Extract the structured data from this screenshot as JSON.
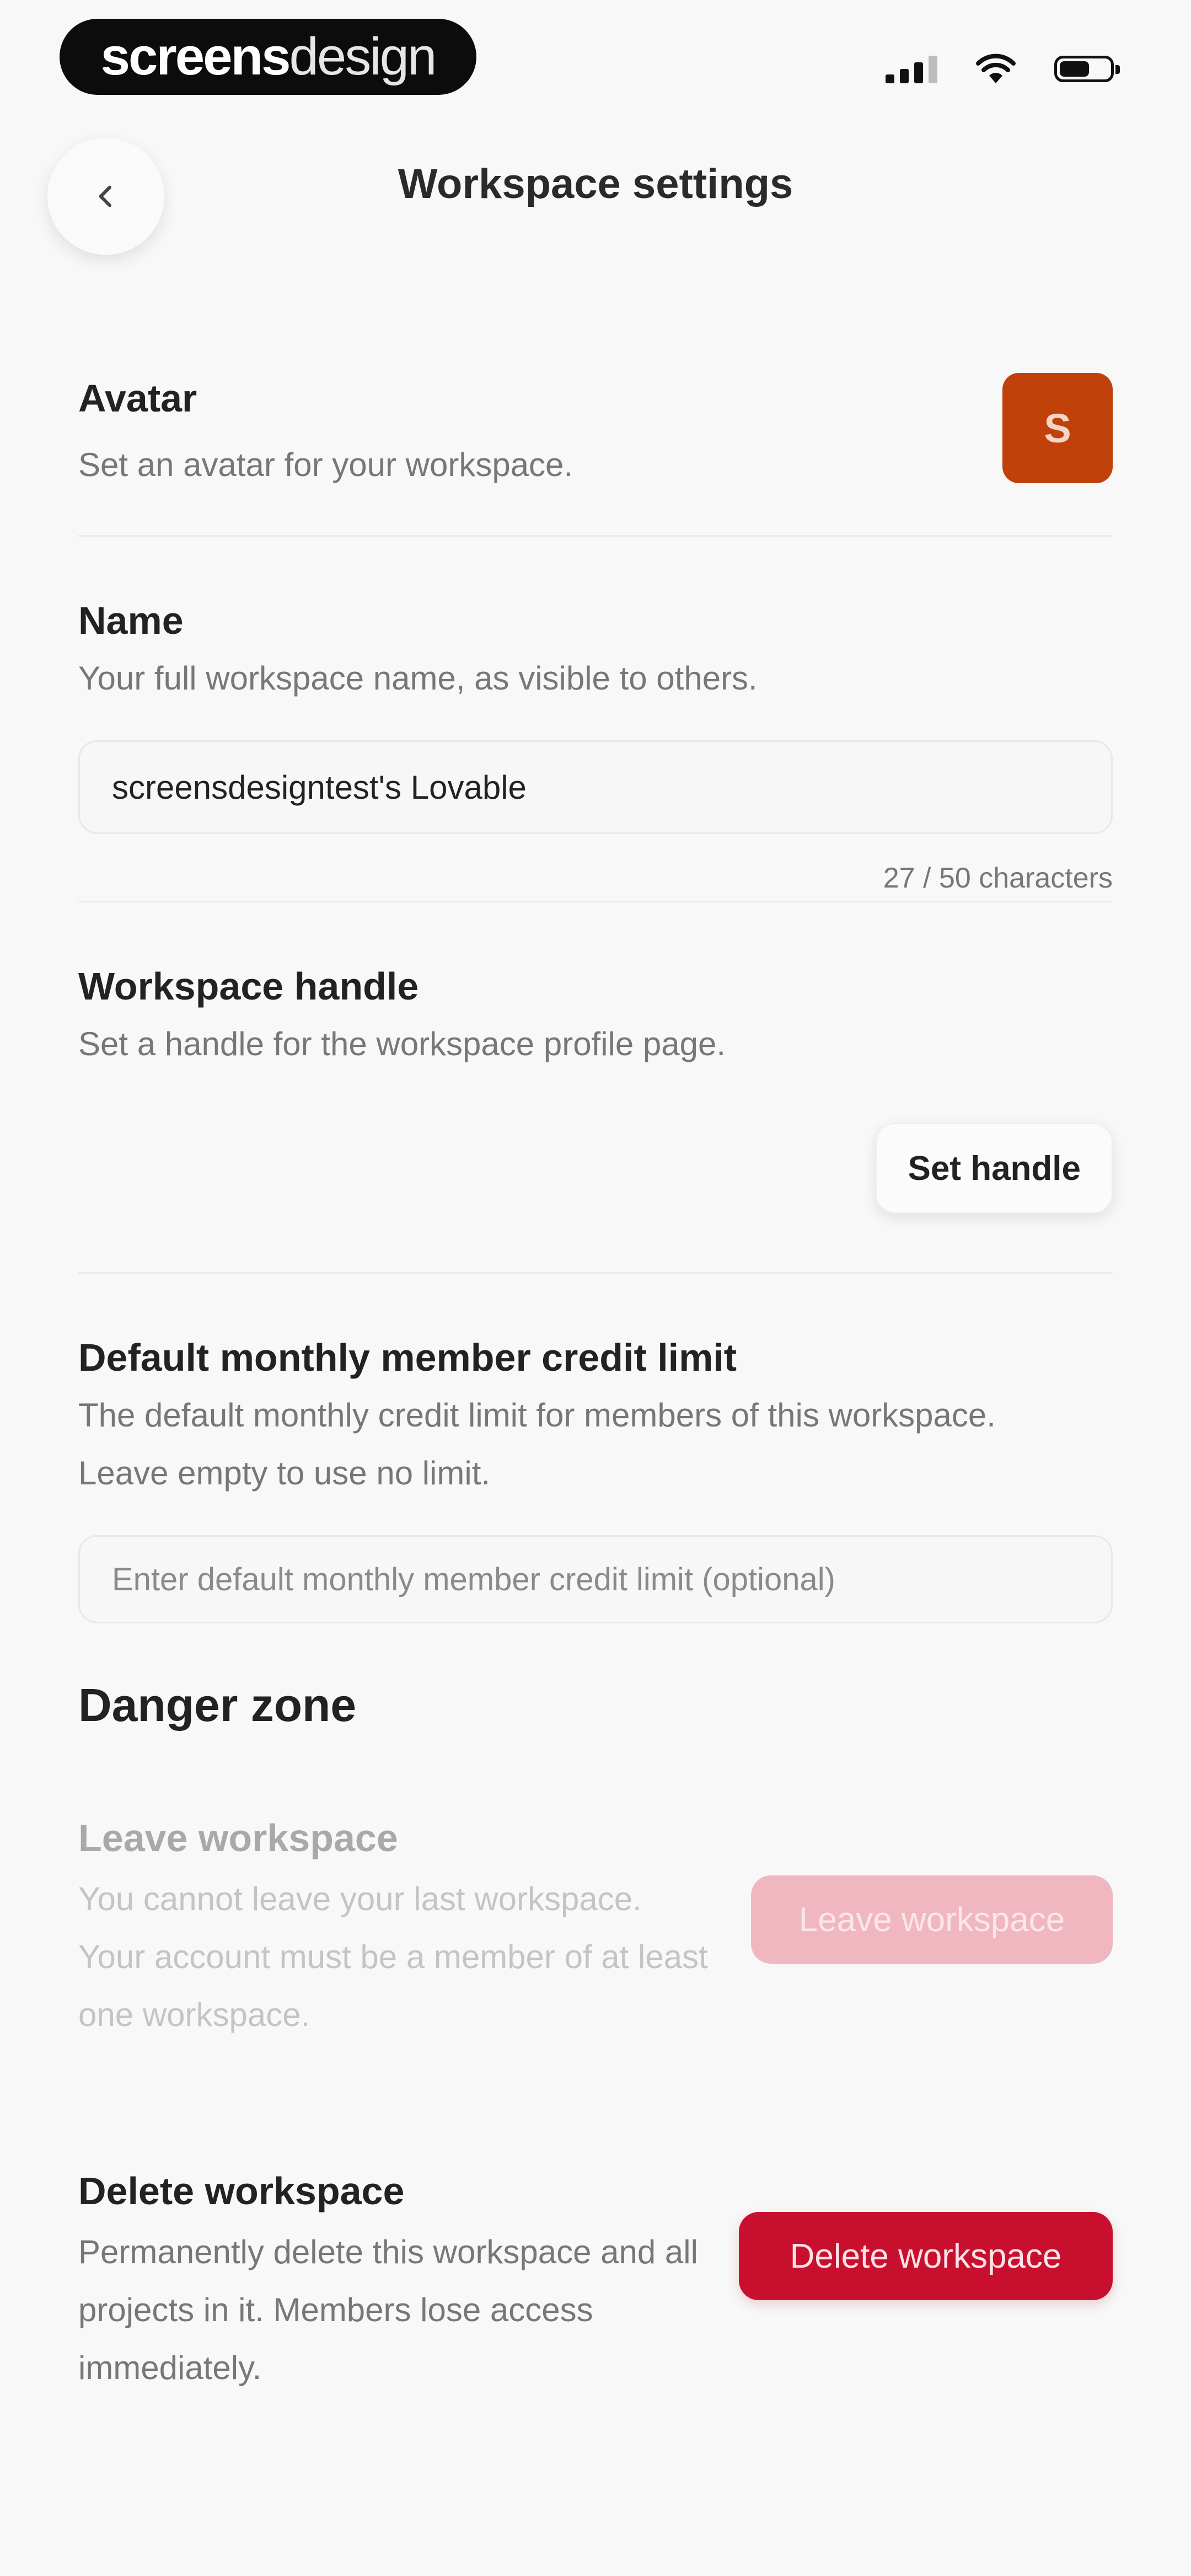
{
  "status_bar": {
    "brand_bold": "screens",
    "brand_light": "design",
    "battery_level": 0.6,
    "icons": [
      "signal-icon",
      "wifi-icon",
      "battery-icon"
    ]
  },
  "header": {
    "title": "Workspace settings",
    "back_icon": "chevron-left-icon"
  },
  "avatar": {
    "label": "Avatar",
    "description": "Set an avatar for your workspace.",
    "initial": "S",
    "color": "#c1410b"
  },
  "name": {
    "label": "Name",
    "description": "Your full workspace name, as visible to others.",
    "value": "screensdesigntest's Lovable",
    "counter": "27 / 50 characters"
  },
  "handle": {
    "label": "Workspace handle",
    "description": "Set a handle for the workspace profile page.",
    "button": "Set handle"
  },
  "credit_limit": {
    "label": "Default monthly member credit limit",
    "description": "The default monthly credit limit for members of this workspace. Leave empty to use no limit.",
    "placeholder": "Enter default monthly member credit limit (optional)"
  },
  "danger_zone": {
    "title": "Danger zone",
    "leave": {
      "label": "Leave workspace",
      "description": "You cannot leave your last workspace. Your account must be a member of at least one workspace.",
      "button": "Leave workspace",
      "disabled": true
    },
    "delete": {
      "label": "Delete workspace",
      "description": "Permanently delete this workspace and all projects in it. Members lose access immediately.",
      "button": "Delete workspace",
      "color": "#c8102e"
    }
  }
}
